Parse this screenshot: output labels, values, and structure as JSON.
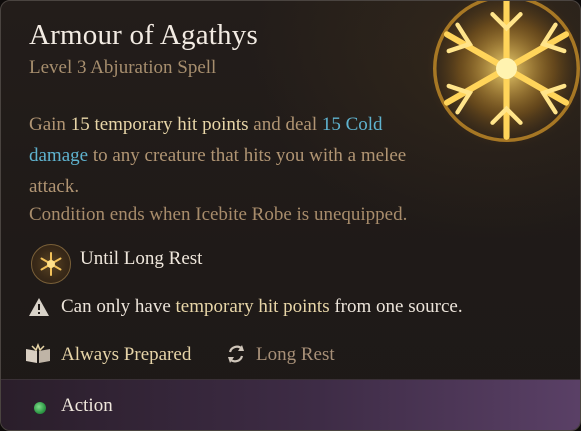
{
  "spell": {
    "name": "Armour of Agathys",
    "subtitle": "Level 3 Abjuration Spell"
  },
  "description": {
    "part1": "Gain ",
    "hp_value": "15",
    "part2": " ",
    "hp_term": "temporary hit points",
    "part3": " and deal ",
    "dmg_value": "15",
    "part4": " ",
    "dmg_term": "Cold damage",
    "part5": " to any creature that hits you with a melee attack."
  },
  "condition": "Condition ends when Icebite Robe is unequipped.",
  "duration": {
    "label": "Until Long Rest",
    "icon": "sun-rest-icon"
  },
  "warning": {
    "icon": "warning-triangle-icon",
    "before": "Can only have ",
    "term": "temporary hit points",
    "after": " from one source."
  },
  "tags": [
    {
      "icon": "open-book-icon",
      "label": "Always Prepared"
    },
    {
      "icon": "cycle-arrows-icon",
      "label": "Long Rest"
    }
  ],
  "footer": {
    "icon": "green-dot-icon",
    "label": "Action"
  },
  "colors": {
    "highlight_tan": "#e8d6a8",
    "highlight_blue": "#5fb3cf",
    "body_text": "#b19573",
    "action_dot": "#2e9a46"
  }
}
